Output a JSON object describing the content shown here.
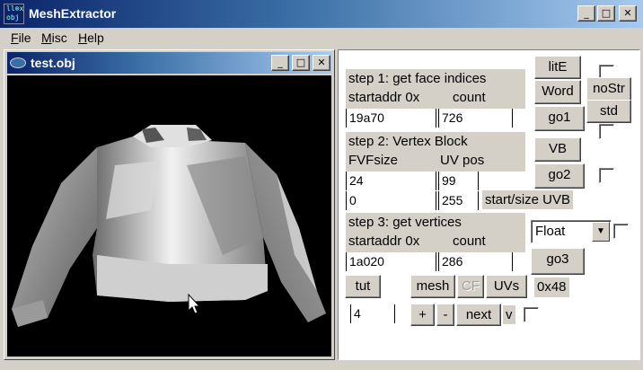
{
  "window": {
    "title": "MeshExtractor",
    "icon": "obj-app-icon",
    "icon_text": "ll⊗x\nobj"
  },
  "caption_buttons": {
    "minimize": "_",
    "maximize": "□",
    "close": "✕"
  },
  "menu": [
    {
      "label": "File",
      "ul": "F",
      "rest": "ile"
    },
    {
      "label": "Misc",
      "ul": "M",
      "rest": "isc"
    },
    {
      "label": "Help",
      "ul": "H",
      "rest": "elp"
    }
  ],
  "child_window": {
    "title": "test.obj"
  },
  "step1": {
    "title": "step 1: get face indices",
    "label_addr": "startaddr 0x",
    "label_count": "count",
    "addr_value": "19a70",
    "count_value": "726"
  },
  "step2": {
    "title": "step 2: Vertex Block",
    "label_fvf": "FVFsize",
    "label_uv": "UV pos",
    "fvf_value": "24",
    "uv_value": "99",
    "start_value": "0",
    "size_value": "255",
    "startsize_label": "start/size UVB"
  },
  "step3": {
    "title": "step 3: get vertices",
    "label_addr": "startaddr 0x",
    "label_count": "count",
    "addr_value": "1a020",
    "count_value": "286",
    "format_selected": "Float"
  },
  "buttons": {
    "lite": "litE",
    "word": "Word",
    "nostr": "noStr",
    "std": "std",
    "go1": "go1",
    "vb": "VB",
    "go2": "go2",
    "go3": "go3",
    "tut": "tut",
    "mesh": "mesh",
    "cf": "CF",
    "uvs": "UVs",
    "plus": "+",
    "minus": "-",
    "next": "next",
    "v": "v"
  },
  "hex_readout": "0x48",
  "nav_value": "4",
  "status_text": "                                                                           "
}
